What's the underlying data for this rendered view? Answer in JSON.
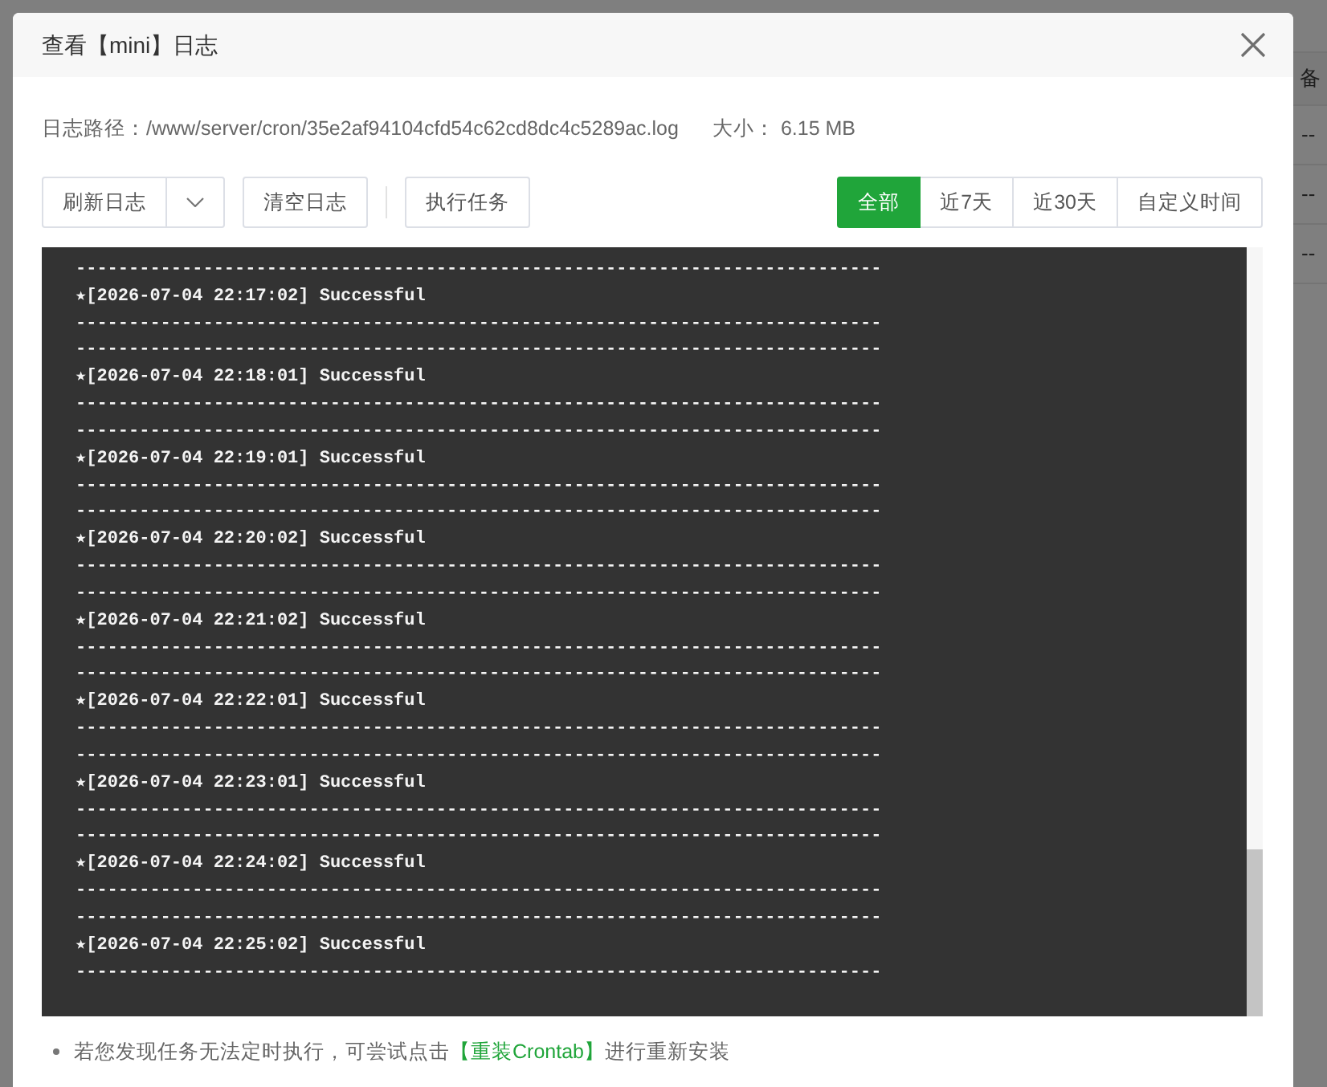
{
  "background_page": {
    "table_header": "备",
    "table_rows": [
      "--",
      "--",
      "--"
    ]
  },
  "dialog": {
    "title": "查看【mini】日志",
    "log_path": "日志路径：/www/server/cron/35e2af94104cfd54c62cd8dc4c5289ac.log",
    "size": "大小： 6.15 MB",
    "actions": [
      {
        "kind": "split",
        "label": "刷新日志"
      },
      {
        "kind": "button",
        "label": "清空日志"
      },
      {
        "kind": "divider"
      },
      {
        "kind": "button",
        "label": "执行任务"
      }
    ],
    "time_filters": [
      {
        "label": "全部",
        "selected": true
      },
      {
        "label": "近7天",
        "selected": false
      },
      {
        "label": "近30天",
        "selected": false
      },
      {
        "label": "自定义时间",
        "selected": false
      }
    ],
    "log_lines": [
      "----------------------------------------------------------------------------",
      "★[2026-07-04 22:17:02] Successful",
      "----------------------------------------------------------------------------",
      "----------------------------------------------------------------------------",
      "★[2026-07-04 22:18:01] Successful",
      "----------------------------------------------------------------------------",
      "----------------------------------------------------------------------------",
      "★[2026-07-04 22:19:01] Successful",
      "----------------------------------------------------------------------------",
      "----------------------------------------------------------------------------",
      "★[2026-07-04 22:20:02] Successful",
      "----------------------------------------------------------------------------",
      "----------------------------------------------------------------------------",
      "★[2026-07-04 22:21:02] Successful",
      "----------------------------------------------------------------------------",
      "----------------------------------------------------------------------------",
      "★[2026-07-04 22:22:01] Successful",
      "----------------------------------------------------------------------------",
      "----------------------------------------------------------------------------",
      "★[2026-07-04 22:23:01] Successful",
      "----------------------------------------------------------------------------",
      "----------------------------------------------------------------------------",
      "★[2026-07-04 22:24:02] Successful",
      "----------------------------------------------------------------------------",
      "----------------------------------------------------------------------------",
      "★[2026-07-04 22:25:02] Successful",
      "----------------------------------------------------------------------------"
    ],
    "tips": [
      {
        "before": "若您发现任务无法定时执行，可尝试点击",
        "link": "【重装Crontab】",
        "after": "进行重新安装"
      }
    ]
  }
}
